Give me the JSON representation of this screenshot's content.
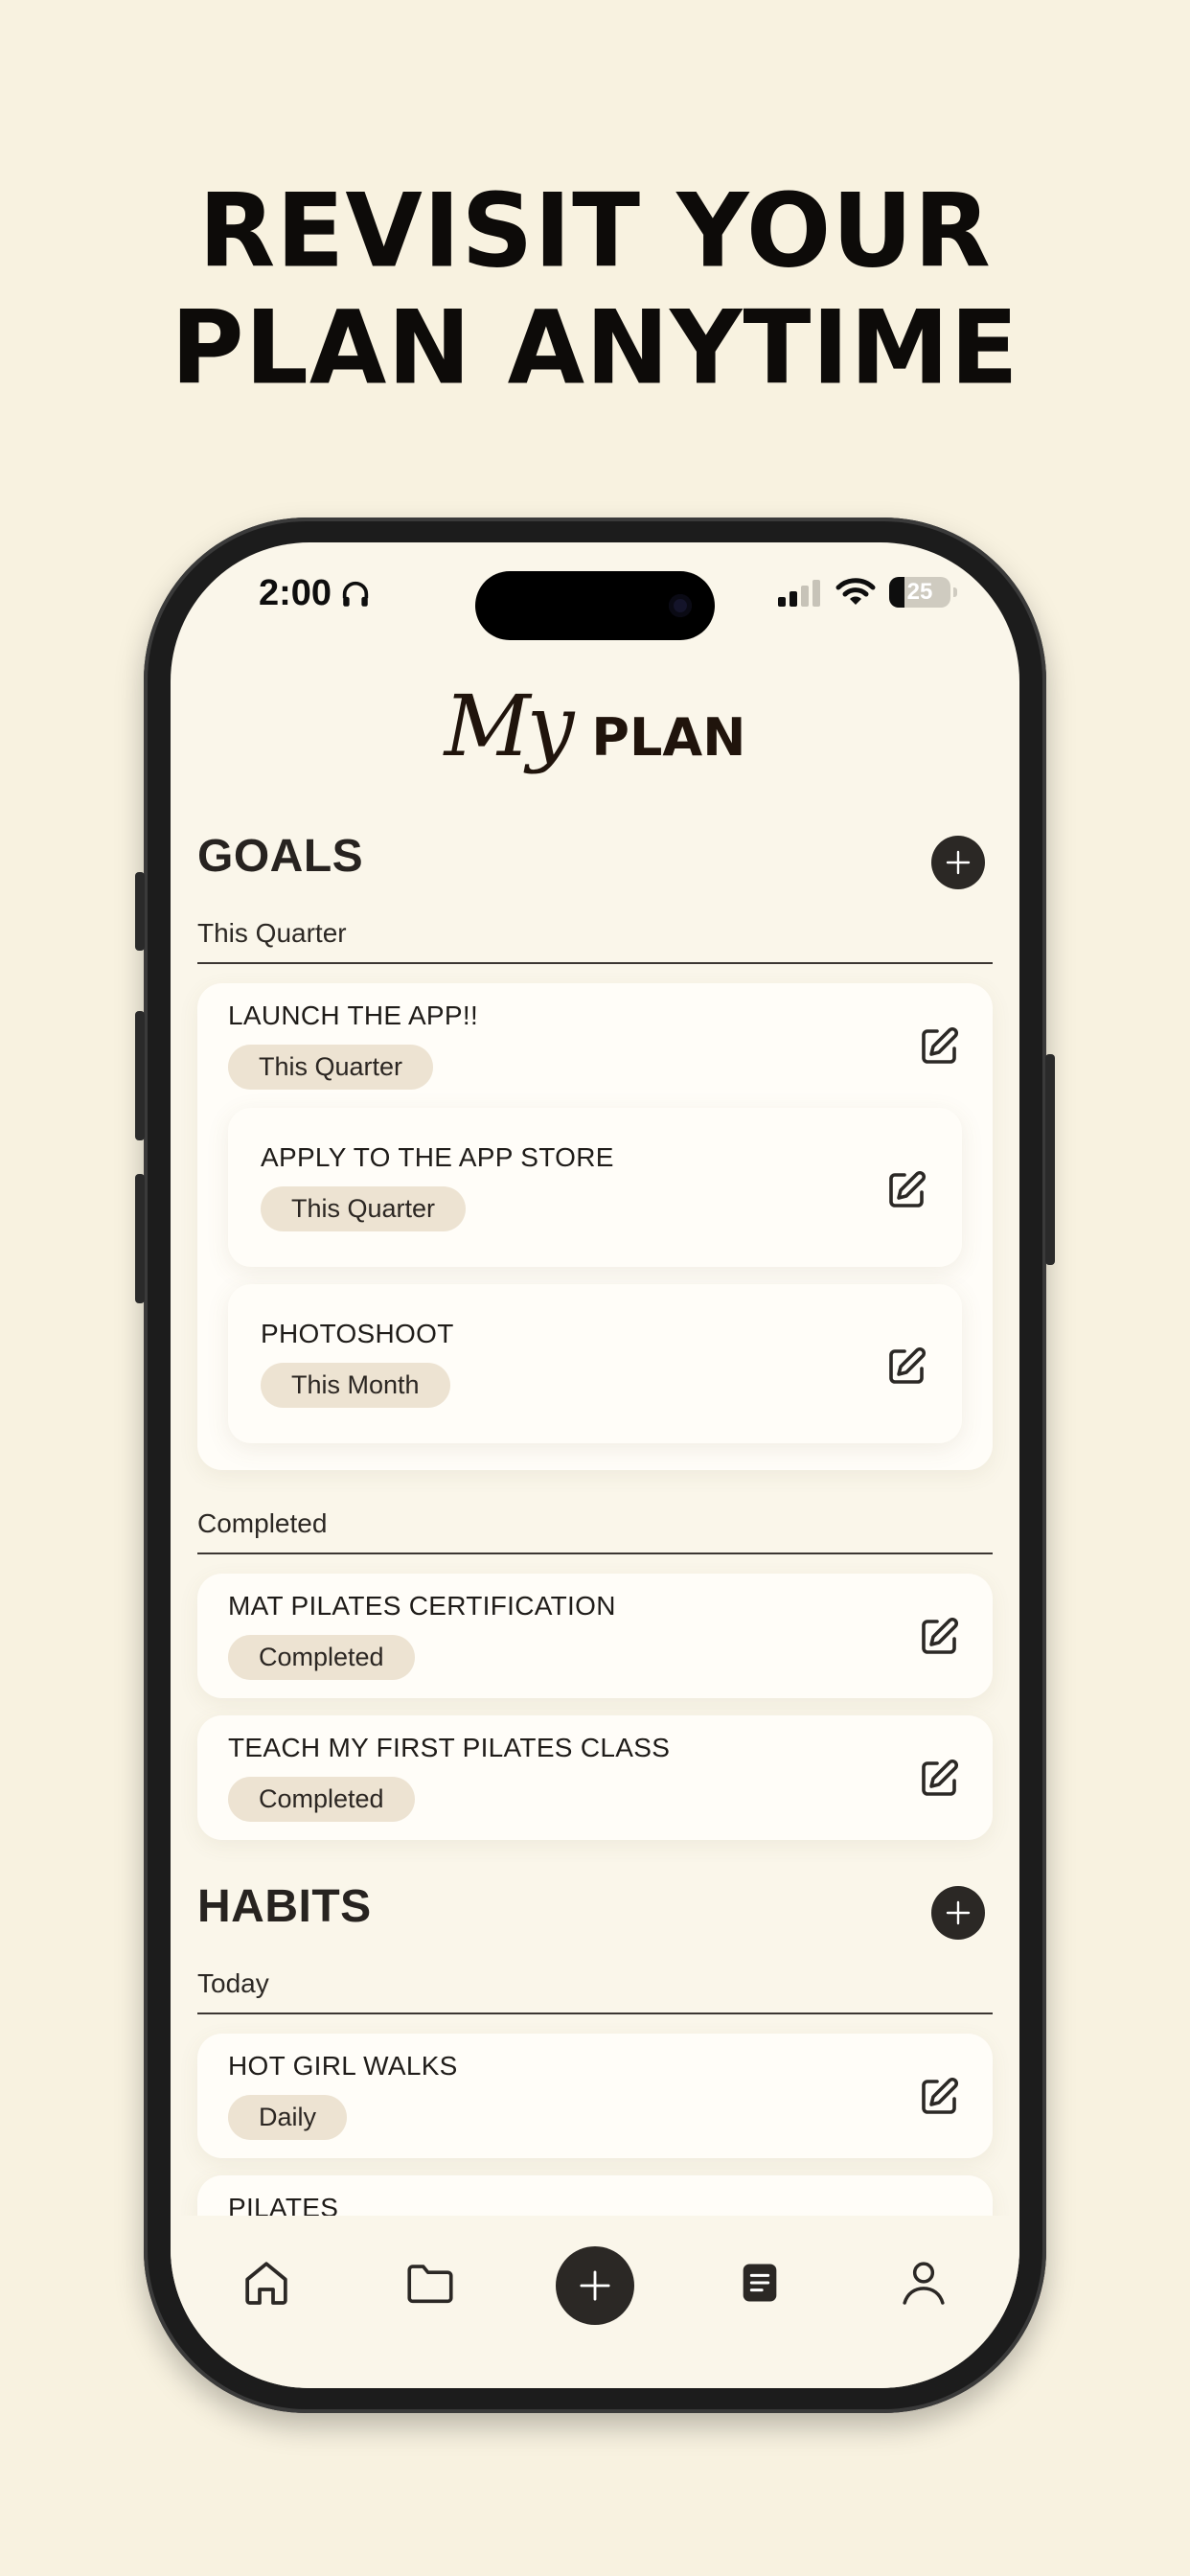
{
  "headline": {
    "line1": "REVISIT YOUR",
    "line2": "PLAN ANYTIME"
  },
  "status_bar": {
    "time": "2:00",
    "battery": "25"
  },
  "app": {
    "title_script": "My",
    "title_bold": "PLAN"
  },
  "goals": {
    "title": "GOALS",
    "group_current": {
      "label": "This Quarter",
      "main": {
        "title": "LAUNCH THE APP!!",
        "tag": "This Quarter"
      },
      "subs": [
        {
          "title": "APPLY TO THE APP STORE",
          "tag": "This Quarter"
        },
        {
          "title": "PHOTOSHOOT",
          "tag": "This Month"
        }
      ]
    },
    "group_completed": {
      "label": "Completed",
      "items": [
        {
          "title": "MAT PILATES CERTIFICATION",
          "tag": "Completed"
        },
        {
          "title": "TEACH MY FIRST PILATES CLASS",
          "tag": "Completed"
        }
      ]
    }
  },
  "habits": {
    "title": "HABITS",
    "group_today": {
      "label": "Today",
      "items": [
        {
          "title": "HOT GIRL WALKS",
          "tag": "Daily"
        },
        {
          "title": "PILATES",
          "tag": ""
        }
      ]
    }
  },
  "icons": {
    "nav": [
      "home-icon",
      "folder-icon",
      "plus-icon",
      "notes-icon",
      "profile-icon"
    ],
    "edit": "edit-icon",
    "headphones": "headphones-icon"
  },
  "colors": {
    "background": "#f8f2e0",
    "screen": "#faf6ea",
    "pill": "#ede3d2",
    "dark": "#2b2825"
  }
}
